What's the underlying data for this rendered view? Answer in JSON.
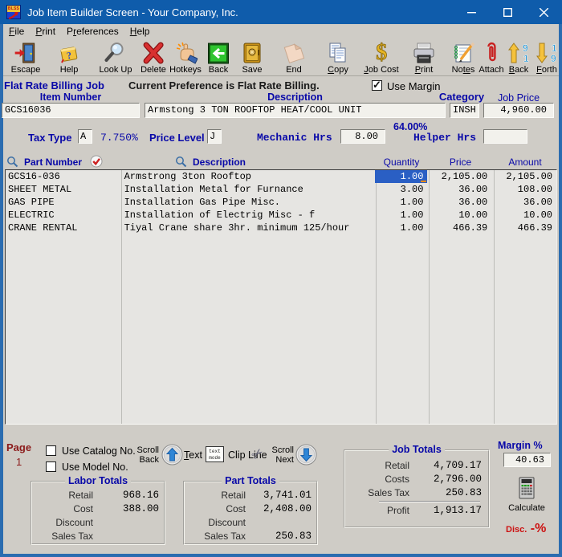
{
  "colors": {
    "titlebar": "#0f5cab",
    "window_border": "#2b6cb0",
    "label_navy": "#0808a8",
    "page_maroon": "#8b1a1a",
    "selected_cell_blue": "#2a5fc4",
    "disc_red": "#cc1111",
    "background_gray": "#cfccc6",
    "table_background": "#e6e5e2"
  },
  "window": {
    "title": "Job Item Builder Screen - Your Company, Inc.",
    "logo_text": "BLSS"
  },
  "menu": {
    "items": [
      {
        "pre": "",
        "key": "F",
        "post": "ile"
      },
      {
        "pre": "",
        "key": "P",
        "post": "rint"
      },
      {
        "pre": "P",
        "key": "r",
        "post": "eferences"
      },
      {
        "pre": "",
        "key": "H",
        "post": "elp"
      }
    ]
  },
  "toolbar": {
    "buttons": [
      {
        "name": "escape",
        "pre": "Escape",
        "key": "",
        "post": ""
      },
      {
        "name": "help",
        "pre": "Help",
        "key": "",
        "post": ""
      },
      {
        "name": "look-up",
        "pre": "Look Up",
        "key": "",
        "post": ""
      },
      {
        "name": "delete",
        "pre": "Delete",
        "key": "",
        "post": ""
      },
      {
        "name": "hotkeys",
        "pre": "Hotkeys",
        "key": "",
        "post": ""
      },
      {
        "name": "back",
        "pre": "Back",
        "key": "",
        "post": ""
      },
      {
        "name": "save",
        "pre": "Save",
        "key": "",
        "post": ""
      },
      {
        "name": "end",
        "pre": "End",
        "key": "",
        "post": ""
      },
      {
        "name": "copy",
        "pre": "",
        "key": "C",
        "post": "opy"
      },
      {
        "name": "job-cost",
        "pre": "",
        "key": "J",
        "post": "ob Cost"
      },
      {
        "name": "print",
        "pre": "",
        "key": "P",
        "post": "rint"
      },
      {
        "name": "notes",
        "pre": "No",
        "key": "te",
        "post": "s"
      },
      {
        "name": "attach",
        "pre": "Attach",
        "key": "",
        "post": ""
      },
      {
        "name": "back-record",
        "pre": "",
        "key": "B",
        "post": "ack"
      },
      {
        "name": "forth",
        "pre": "",
        "key": "F",
        "post": "orth"
      }
    ]
  },
  "form": {
    "flat_rate_label": "Flat Rate Billing Job",
    "preference_note": "Current Preference is Flat Rate Billing.",
    "use_margin_label": "Use Margin",
    "use_margin_checked": true,
    "item_number_label": "Item Number",
    "item_number": "GCS16036",
    "description_label": "Description",
    "description": "Armstong 3 TON ROOFTOP HEAT/COOL UNIT",
    "category_label": "Category",
    "category": "INSH",
    "job_price_label": "Job Price",
    "job_price": "4,960.00",
    "margin_pct": "64.00%",
    "tax_type_label": "Tax Type",
    "tax_type": "A",
    "tax_rate": "7.750%",
    "price_level_label": "Price Level",
    "price_level": "J",
    "mechanic_label": "Mechanic Hrs",
    "mechanic_hrs": "8.00",
    "helper_label": "Helper Hrs",
    "helper_hrs": ""
  },
  "parts_table": {
    "headers": {
      "part_number": "Part Number",
      "description": "Description",
      "quantity": "Quantity",
      "price": "Price",
      "amount": "Amount"
    },
    "rows": [
      {
        "part_number": "GCS16-036",
        "description": "Armstrong 3ton Rooftop",
        "quantity": "1.00",
        "price": "2,105.00",
        "amount": "2,105.00"
      },
      {
        "part_number": "SHEET METAL",
        "description": "Installation Metal for Furnance",
        "quantity": "3.00",
        "price": "36.00",
        "amount": "108.00"
      },
      {
        "part_number": "GAS PIPE",
        "description": "Installation Gas Pipe Misc.",
        "quantity": "1.00",
        "price": "36.00",
        "amount": "36.00"
      },
      {
        "part_number": "ELECTRIC",
        "description": "Installation of Electrig Misc - f",
        "quantity": "1.00",
        "price": "10.00",
        "amount": "10.00"
      },
      {
        "part_number": "CRANE RENTAL",
        "description": "Tiyal Crane share 3hr. minimum 125/hour",
        "quantity": "1.00",
        "price": "466.39",
        "amount": "466.39"
      }
    ]
  },
  "footer": {
    "page": {
      "label": "Page",
      "number": "1"
    },
    "options": {
      "use_catalog": "Use Catalog No.",
      "use_model": "Use Model No."
    },
    "scroll_back": {
      "line1": "Scroll",
      "line2": "Back"
    },
    "scroll_next": {
      "line1": "Scroll",
      "line2": "Next"
    },
    "text_button": {
      "pre": "",
      "key": "T",
      "post": "ext"
    },
    "text_mode": {
      "line1": "text",
      "line2": "mode"
    },
    "clip_line": "Clip Line"
  },
  "labor_totals": {
    "title": "Labor Totals",
    "retail_label": "Retail",
    "retail": "968.16",
    "cost_label": "Cost",
    "cost": "388.00",
    "discount_label": "Discount",
    "discount": "",
    "sales_tax_label": "Sales Tax",
    "sales_tax": ""
  },
  "part_totals": {
    "title": "Part Totals",
    "retail_label": "Retail",
    "retail": "3,741.01",
    "cost_label": "Cost",
    "cost": "2,408.00",
    "discount_label": "Discount",
    "discount": "",
    "sales_tax_label": "Sales Tax",
    "sales_tax": "250.83"
  },
  "job_totals": {
    "title": "Job Totals",
    "retail_label": "Retail",
    "retail": "4,709.17",
    "costs_label": "Costs",
    "costs": "2,796.00",
    "sales_tax_label": "Sales Tax",
    "sales_tax": "250.83",
    "profit_label": "Profit",
    "profit": "1,913.17"
  },
  "margin": {
    "label": "Margin %",
    "value": "40.63"
  },
  "calc": {
    "label": "Calculate"
  },
  "disc": {
    "label": "Disc.",
    "symbol": "-%"
  }
}
